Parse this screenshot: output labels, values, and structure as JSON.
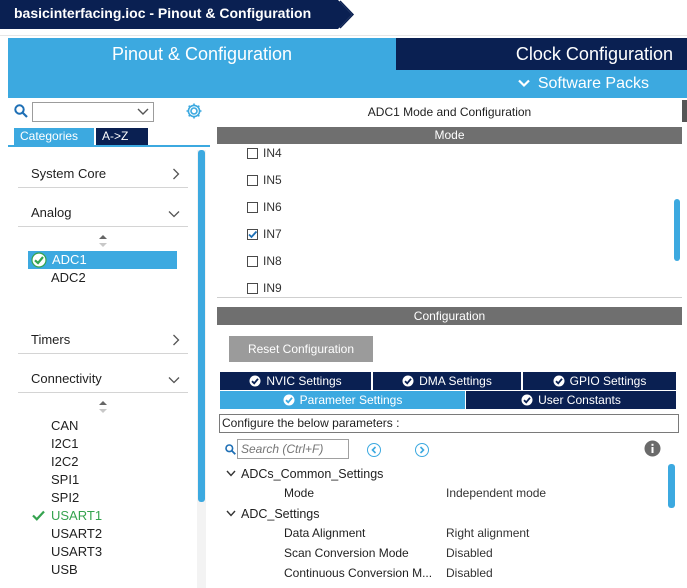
{
  "window": {
    "title": "basicinterfacing.ioc - Pinout & Configuration"
  },
  "main_tabs": {
    "pinout": "Pinout & Configuration",
    "clock": "Clock Configuration",
    "software_packs": "Software Packs"
  },
  "left": {
    "search_value": "",
    "tabs": {
      "categories": "Categories",
      "az": "A->Z"
    },
    "categories": [
      {
        "label": "System Core",
        "state": "collapsed"
      },
      {
        "label": "Analog",
        "state": "expanded"
      },
      {
        "label": "Timers",
        "state": "collapsed"
      },
      {
        "label": "Connectivity",
        "state": "expanded"
      }
    ],
    "analog_items": [
      {
        "label": "ADC1",
        "selected": true,
        "status": "ok"
      },
      {
        "label": "ADC2",
        "selected": false,
        "status": ""
      }
    ],
    "connectivity_items": [
      {
        "label": "CAN",
        "status": ""
      },
      {
        "label": "I2C1",
        "status": ""
      },
      {
        "label": "I2C2",
        "status": ""
      },
      {
        "label": "SPI1",
        "status": ""
      },
      {
        "label": "SPI2",
        "status": ""
      },
      {
        "label": "USART1",
        "status": "ok"
      },
      {
        "label": "USART2",
        "status": ""
      },
      {
        "label": "USART3",
        "status": ""
      },
      {
        "label": "USB",
        "status": ""
      }
    ]
  },
  "mode_panel": {
    "title": "ADC1 Mode and Configuration",
    "header": "Mode",
    "channels": [
      {
        "label": "IN4",
        "checked": false
      },
      {
        "label": "IN5",
        "checked": false
      },
      {
        "label": "IN6",
        "checked": false
      },
      {
        "label": "IN7",
        "checked": true
      },
      {
        "label": "IN8",
        "checked": false
      },
      {
        "label": "IN9",
        "checked": false
      }
    ]
  },
  "config_panel": {
    "header": "Configuration",
    "reset_label": "Reset Configuration",
    "tabs": [
      {
        "label": "NVIC Settings",
        "active": false
      },
      {
        "label": "DMA Settings",
        "active": false
      },
      {
        "label": "GPIO Settings",
        "active": false
      },
      {
        "label": "Parameter Settings",
        "active": true
      },
      {
        "label": "User Constants",
        "active": false
      }
    ],
    "note": "Configure the below parameters :",
    "search_placeholder": "Search (Ctrl+F)",
    "groups": [
      {
        "name": "ADCs_Common_Settings",
        "params": [
          {
            "name": "Mode",
            "value": "Independent mode"
          }
        ]
      },
      {
        "name": "ADC_Settings",
        "params": [
          {
            "name": "Data Alignment",
            "value": "Right alignment"
          },
          {
            "name": "Scan Conversion Mode",
            "value": "Disabled"
          },
          {
            "name": "Continuous Conversion M...",
            "value": "Disabled"
          }
        ]
      }
    ]
  },
  "colors": {
    "navy": "#0a2052",
    "accent": "#3ca9e0",
    "ok_green": "#35a34f",
    "header_gray": "#6f6f6f"
  }
}
